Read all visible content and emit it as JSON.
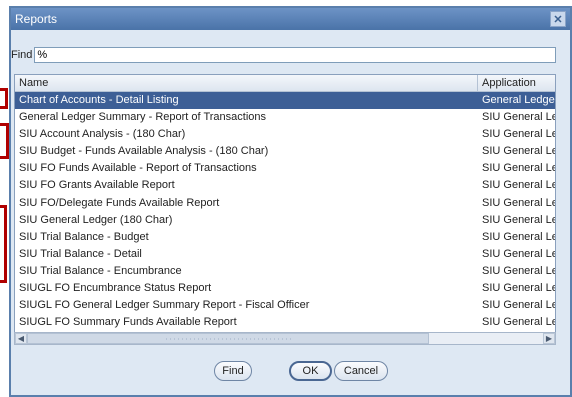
{
  "window": {
    "title": "Reports",
    "close_glyph": "✕"
  },
  "find": {
    "label": "Find",
    "value": "%"
  },
  "list": {
    "columns": [
      "Name",
      "Application"
    ],
    "rows": [
      [
        "Chart of Accounts - Detail Listing",
        "General Ledge"
      ],
      [
        "General Ledger Summary - Report of Transactions",
        "SIU General Le"
      ],
      [
        "SIU Account Analysis - (180 Char)",
        "SIU General Le"
      ],
      [
        "SIU Budget - Funds Available Analysis - (180 Char)",
        "SIU General Le"
      ],
      [
        "SIU FO Funds Available - Report of Transactions",
        "SIU General Le"
      ],
      [
        "SIU FO Grants Available Report",
        "SIU General Le"
      ],
      [
        "SIU FO/Delegate Funds Available Report",
        "SIU General Le"
      ],
      [
        "SIU General Ledger (180 Char)",
        "SIU General Le"
      ],
      [
        "SIU Trial Balance - Budget",
        "SIU General Le"
      ],
      [
        "SIU Trial Balance - Detail",
        "SIU General Le"
      ],
      [
        "SIU Trial Balance - Encumbrance",
        "SIU General Le"
      ],
      [
        "SIUGL FO Encumbrance Status Report",
        "SIU General Le"
      ],
      [
        "SIUGL FO General Ledger Summary Report - Fiscal Officer",
        "SIU General Le"
      ],
      [
        "SIUGL FO Summary Funds Available Report",
        "SIU General Le"
      ]
    ],
    "selected_index": 0
  },
  "scrollbar": {
    "left_arrow": "◀",
    "right_arrow": "▶"
  },
  "buttons": {
    "find": "Find",
    "ok": "OK",
    "cancel": "Cancel"
  }
}
